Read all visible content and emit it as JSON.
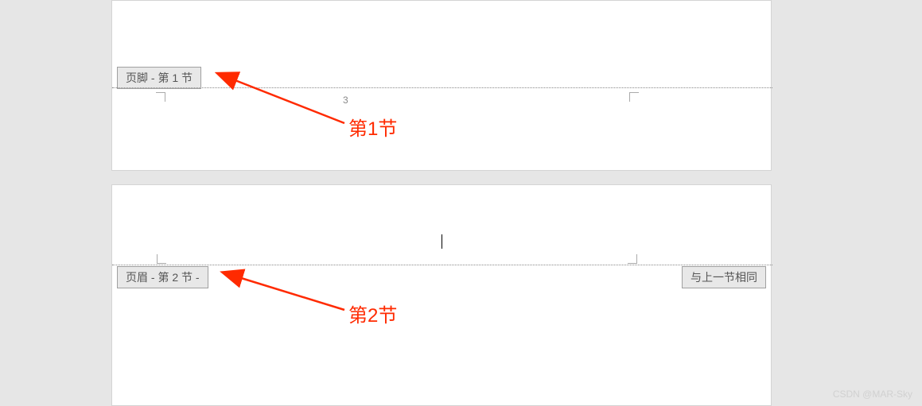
{
  "page1": {
    "footer_tag": "页脚 - 第 1 节",
    "page_number": "3"
  },
  "page2": {
    "header_tag": "页眉 - 第 2 节 -",
    "link_tag": "与上一节相同"
  },
  "annotations": {
    "label1": "第1节",
    "label2": "第2节"
  },
  "watermark": "CSDN @MAR-Sky"
}
